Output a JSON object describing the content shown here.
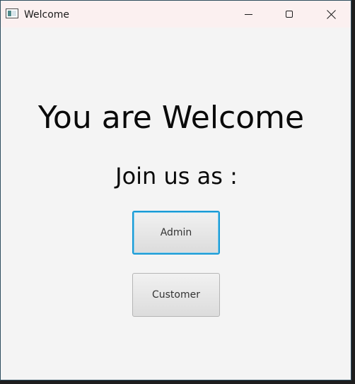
{
  "window": {
    "title": "Welcome",
    "controls": {
      "minimize_icon": "minimize-icon",
      "maximize_icon": "maximize-icon",
      "close_icon": "close-icon"
    }
  },
  "main": {
    "heading": "You are Welcome",
    "subheading": "Join us as :",
    "buttons": {
      "admin": "Admin",
      "customer": "Customer"
    }
  },
  "colors": {
    "focus_border": "#1a9bd6",
    "window_bg": "#f4f4f4",
    "titlebar_bg": "#fbf0f0"
  }
}
